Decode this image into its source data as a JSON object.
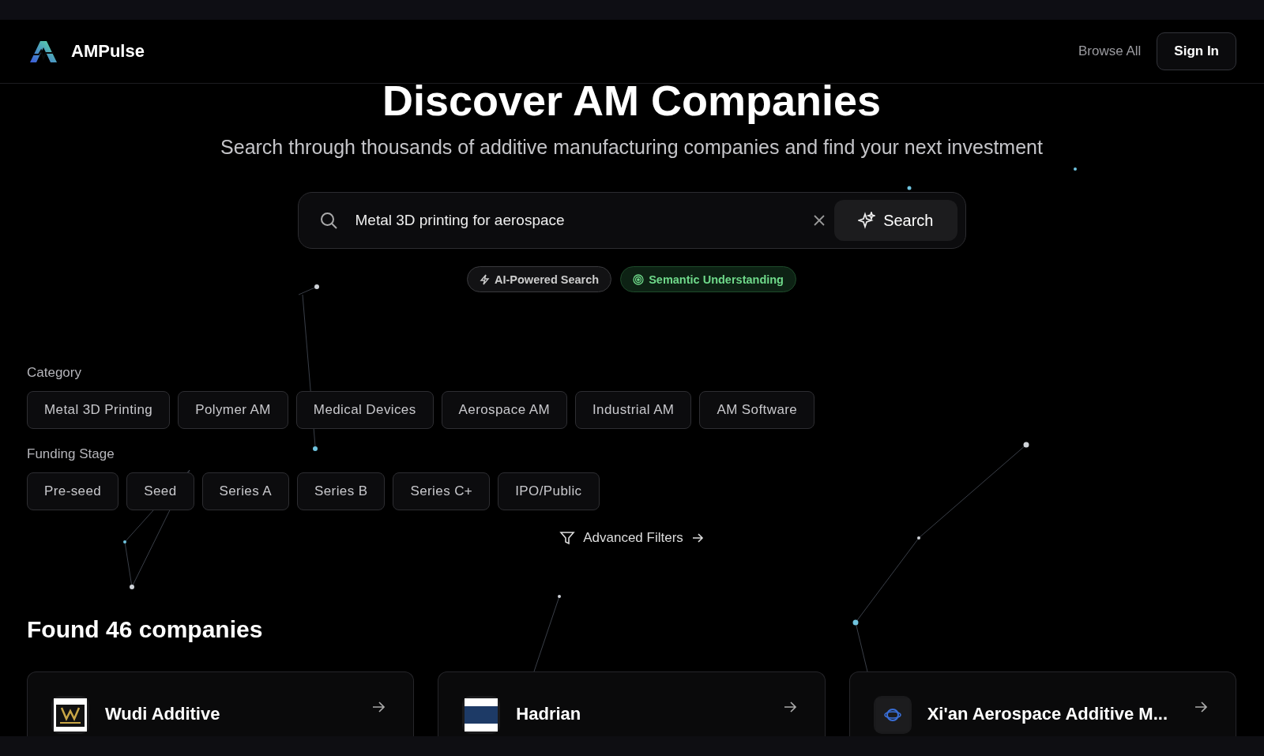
{
  "header": {
    "brand": "AMPulse",
    "nav_link": "Browse All",
    "sign_in": "Sign In"
  },
  "hero": {
    "title": "Discover AM Companies",
    "subtitle": "Search through thousands of additive manufacturing companies and find your next investment"
  },
  "search": {
    "value": "Metal 3D printing for aerospace",
    "button": "Search"
  },
  "badges": [
    {
      "label": "AI-Powered Search",
      "kind": "bolt"
    },
    {
      "label": "Semantic Understanding",
      "kind": "semantic"
    }
  ],
  "filters": [
    {
      "label": "Category",
      "options": [
        {
          "label": "Metal 3D Printing",
          "selected": false
        },
        {
          "label": "Polymer AM",
          "selected": false
        },
        {
          "label": "Medical Devices",
          "selected": false
        },
        {
          "label": "Aerospace AM",
          "selected": false
        },
        {
          "label": "Industrial AM",
          "selected": false
        },
        {
          "label": "AM Software",
          "selected": false
        }
      ]
    },
    {
      "label": "Funding Stage",
      "options": [
        {
          "label": "Pre-seed",
          "selected": false
        },
        {
          "label": "Seed",
          "selected": false
        },
        {
          "label": "Series A",
          "selected": false
        },
        {
          "label": "Series B",
          "selected": false
        },
        {
          "label": "Series C+",
          "selected": false
        },
        {
          "label": "IPO/Public",
          "selected": false
        }
      ]
    }
  ],
  "advanced_filters": "Advanced Filters",
  "results_title": "Found 46 companies",
  "companies": [
    {
      "name": "Wudi Additive",
      "kind": "wudi"
    },
    {
      "name": "Hadrian",
      "kind": "stripes"
    },
    {
      "name": "Xi'an Aerospace Additive M...",
      "kind": "globe"
    }
  ]
}
